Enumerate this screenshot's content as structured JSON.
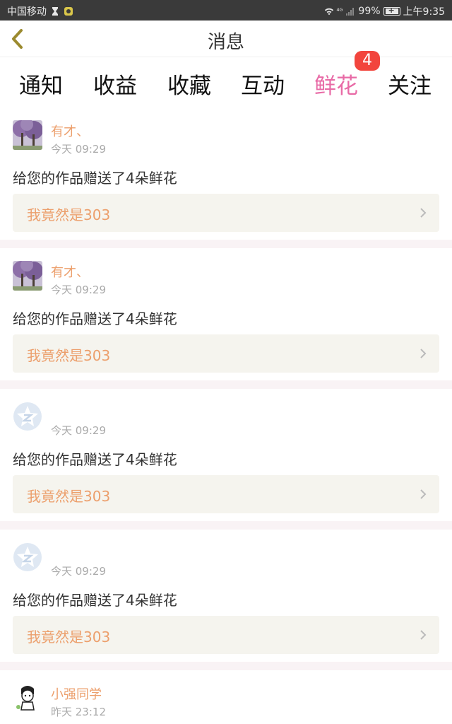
{
  "status_bar": {
    "carrier": "中国移动",
    "signal_label": "⁴ᴳ",
    "battery": "99%",
    "time": "上午9:35"
  },
  "header": {
    "title": "消息",
    "back_icon": "back-chevron-icon"
  },
  "tabs": [
    {
      "label": "通知",
      "active": false
    },
    {
      "label": "收益",
      "active": false
    },
    {
      "label": "收藏",
      "active": false
    },
    {
      "label": "互动",
      "active": false
    },
    {
      "label": "鲜花",
      "active": true,
      "badge": "4"
    },
    {
      "label": "关注",
      "active": false
    }
  ],
  "colors": {
    "accent": "#e86aa6",
    "username": "#ec9f6c",
    "badge": "#f2453d"
  },
  "messages": [
    {
      "user": "有才、",
      "time": "今天 09:29",
      "text": "给您的作品赠送了4朵鲜花",
      "work": "我竟然是303",
      "avatar": "tree-photo"
    },
    {
      "user": "有才、",
      "time": "今天 09:29",
      "text": "给您的作品赠送了4朵鲜花",
      "work": "我竟然是303",
      "avatar": "tree-photo"
    },
    {
      "user": "",
      "time": "今天 09:29",
      "text": "给您的作品赠送了4朵鲜花",
      "work": "我竟然是303",
      "avatar": "default-star-avatar"
    },
    {
      "user": "",
      "time": "今天 09:29",
      "text": "给您的作品赠送了4朵鲜花",
      "work": "我竟然是303",
      "avatar": "default-star-avatar"
    },
    {
      "user": "小强同学",
      "time": "昨天 23:12",
      "text": "",
      "work": "",
      "avatar": "cartoon-boy-avatar"
    }
  ]
}
